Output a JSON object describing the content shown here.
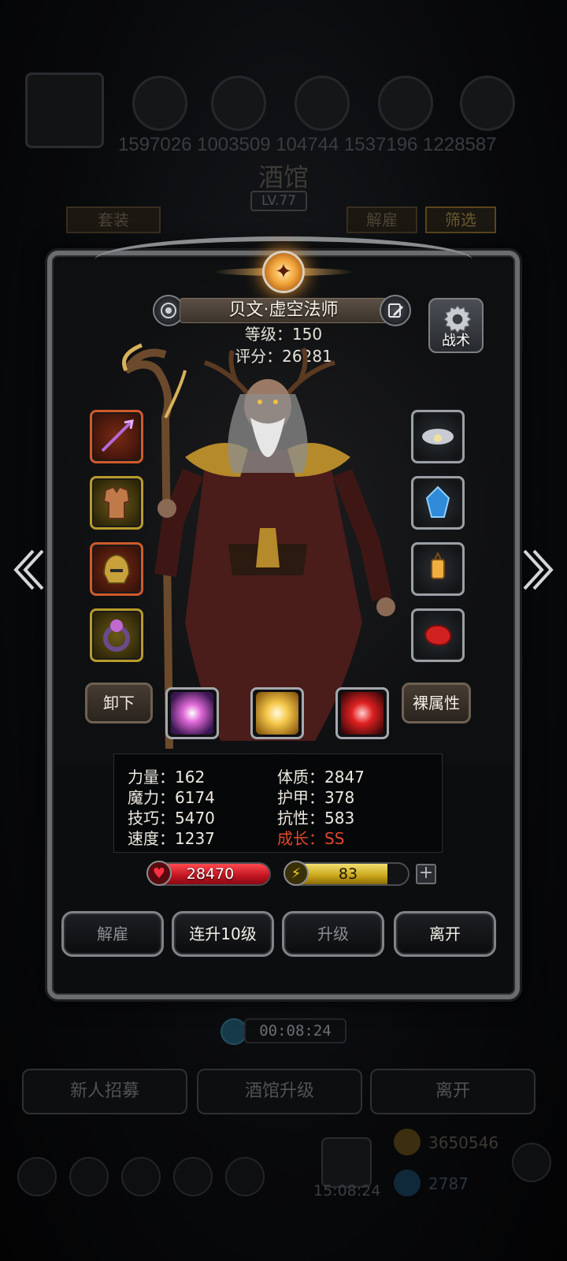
{
  "background": {
    "resource_values": "1597026 1003509 104744 1537196 1228587",
    "title": "酒馆",
    "level": "LV.77",
    "tab_left": "套装",
    "tab_dismiss": "解雇",
    "tab_filter": "筛选",
    "timer": "00:08:24",
    "btn_recruit": "新人招募",
    "btn_upgrade_tavern": "酒馆升级",
    "btn_leave": "离开",
    "coins": "3650546",
    "gems": "2787",
    "clock": "15:08:24"
  },
  "hero": {
    "name": "贝文·虚空法师",
    "level_line": "等级：150",
    "score_line": "评分：26281",
    "tactics_label": "战术"
  },
  "equipment": {
    "left": [
      "weapon-staff",
      "chest-armor",
      "helmet",
      "ring"
    ],
    "right": [
      "cloud-charm",
      "blue-crystal",
      "lantern",
      "red-gem"
    ]
  },
  "actions": {
    "unequip": "卸下",
    "bare_stats": "裸属性"
  },
  "skills": [
    "violet-crystal-skill",
    "golden-burst-skill",
    "crimson-slash-skill"
  ],
  "stats": {
    "strength": "力量：162",
    "magic": "魔力：6174",
    "skill": "技巧：5470",
    "speed": "速度：1237",
    "constitution": "体质：2847",
    "armor": "护甲：378",
    "resistance": "抗性：583",
    "growth": "成长：SS"
  },
  "bars": {
    "hp": "28470",
    "hp_fill": 1.0,
    "energy": "83",
    "energy_fill": 0.83
  },
  "buttons": {
    "dismiss": "解雇",
    "level_up_10": "连升10级",
    "level_up": "升级",
    "leave": "离开"
  },
  "colors": {
    "growth": "#e2472d",
    "hp": "#d0202a",
    "energy": "#d4bb2a"
  }
}
